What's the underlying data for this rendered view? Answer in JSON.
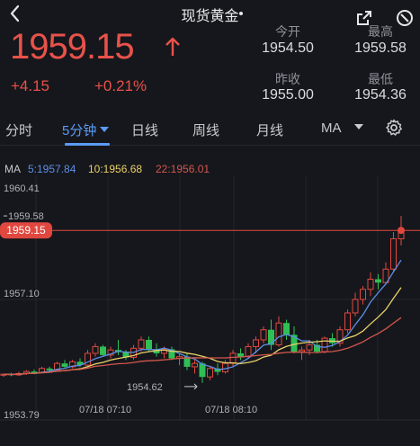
{
  "header": {
    "title": "现货黄金",
    "back_icon": "chevron-left-icon",
    "share_icon": "share-icon",
    "more_icon": "more-icon"
  },
  "quote": {
    "price": "1959.15",
    "change": "+4.15",
    "change_pct": "+0.21%",
    "direction_icon": "arrow-up-icon",
    "color_up": "#e8524a"
  },
  "stats": {
    "open_label": "今开",
    "open": "1954.50",
    "high_label": "最高",
    "high": "1959.58",
    "prev_close_label": "昨收",
    "prev_close": "1955.00",
    "low_label": "最低",
    "low": "1954.36"
  },
  "tabs": [
    {
      "label": "分时",
      "active": false
    },
    {
      "label": "5分钟",
      "active": true,
      "dropdown": true
    },
    {
      "label": "日线",
      "active": false
    },
    {
      "label": "周线",
      "active": false
    },
    {
      "label": "月线",
      "active": false
    },
    {
      "label": "MA",
      "active": false,
      "dropdown": true
    }
  ],
  "settings_icon": "gear-icon",
  "ma_legend": {
    "title": "MA",
    "ma5": "5:1957.84",
    "ma10": "10:1956.68",
    "ma22": "22:1956.01",
    "colors": {
      "ma5": "#5b8fe6",
      "ma10": "#e9d169",
      "ma22": "#d2574d"
    }
  },
  "chart_data": {
    "type": "candlestick",
    "y_ticks": [
      "1960.41",
      "1957.10",
      "1953.79"
    ],
    "x_ticks": [
      "07/18 07:10",
      "07/18 08:10"
    ],
    "ylim": [
      1953.79,
      1960.41
    ],
    "high_marker": "1959.58",
    "low_marker": "1954.62",
    "last_price_tag": "1959.15",
    "last_price": 1959.15,
    "colors": {
      "up": "#e0483f",
      "down": "#2fbf55"
    },
    "candles": [
      [
        1954.85,
        1954.9,
        1954.8,
        1954.88
      ],
      [
        1954.88,
        1954.92,
        1954.82,
        1954.86
      ],
      [
        1954.86,
        1954.95,
        1954.83,
        1954.9
      ],
      [
        1954.9,
        1955.0,
        1954.86,
        1954.96
      ],
      [
        1954.96,
        1955.02,
        1954.88,
        1954.92
      ],
      [
        1954.92,
        1955.1,
        1954.9,
        1955.05
      ],
      [
        1955.05,
        1955.1,
        1954.95,
        1955.0
      ],
      [
        1955.0,
        1955.25,
        1954.98,
        1955.2
      ],
      [
        1955.2,
        1955.3,
        1955.05,
        1955.1
      ],
      [
        1955.1,
        1955.3,
        1955.05,
        1955.25
      ],
      [
        1955.25,
        1955.35,
        1955.1,
        1955.15
      ],
      [
        1955.15,
        1955.6,
        1955.12,
        1955.5
      ],
      [
        1955.5,
        1955.8,
        1955.4,
        1955.7
      ],
      [
        1955.7,
        1955.75,
        1955.4,
        1955.45
      ],
      [
        1955.45,
        1955.7,
        1955.35,
        1955.6
      ],
      [
        1955.6,
        1955.9,
        1955.45,
        1955.55
      ],
      [
        1955.55,
        1955.6,
        1955.3,
        1955.38
      ],
      [
        1955.38,
        1955.75,
        1955.3,
        1955.65
      ],
      [
        1955.65,
        1956.0,
        1955.55,
        1955.9
      ],
      [
        1955.9,
        1956.0,
        1955.55,
        1955.6
      ],
      [
        1955.6,
        1955.8,
        1955.4,
        1955.5
      ],
      [
        1955.5,
        1955.7,
        1955.35,
        1955.62
      ],
      [
        1955.62,
        1955.7,
        1955.3,
        1955.35
      ],
      [
        1955.35,
        1955.5,
        1955.15,
        1955.4
      ],
      [
        1955.4,
        1955.5,
        1955.0,
        1955.1
      ],
      [
        1955.1,
        1955.3,
        1954.9,
        1955.2
      ],
      [
        1955.2,
        1955.25,
        1954.62,
        1954.8
      ],
      [
        1954.8,
        1955.1,
        1954.7,
        1955.05
      ],
      [
        1955.05,
        1955.2,
        1954.85,
        1954.95
      ],
      [
        1954.95,
        1955.3,
        1954.9,
        1955.2
      ],
      [
        1955.2,
        1955.6,
        1955.1,
        1955.5
      ],
      [
        1955.5,
        1955.65,
        1955.3,
        1955.4
      ],
      [
        1955.4,
        1955.8,
        1955.35,
        1955.7
      ],
      [
        1955.7,
        1956.0,
        1955.5,
        1955.9
      ],
      [
        1955.9,
        1956.3,
        1955.8,
        1956.2
      ],
      [
        1956.2,
        1956.5,
        1955.6,
        1955.75
      ],
      [
        1955.75,
        1956.6,
        1955.7,
        1956.4
      ],
      [
        1956.4,
        1956.5,
        1955.9,
        1956.05
      ],
      [
        1956.05,
        1956.3,
        1955.5,
        1955.55
      ],
      [
        1955.55,
        1955.7,
        1955.3,
        1955.6
      ],
      [
        1955.6,
        1955.9,
        1955.45,
        1955.75
      ],
      [
        1955.75,
        1955.9,
        1955.5,
        1955.55
      ],
      [
        1955.55,
        1956.0,
        1955.5,
        1955.95
      ],
      [
        1955.95,
        1956.1,
        1955.7,
        1955.8
      ],
      [
        1955.8,
        1956.3,
        1955.7,
        1956.2
      ],
      [
        1956.2,
        1956.8,
        1956.1,
        1956.7
      ],
      [
        1956.7,
        1957.3,
        1956.6,
        1957.1
      ],
      [
        1957.1,
        1957.5,
        1956.95,
        1957.4
      ],
      [
        1957.4,
        1957.9,
        1957.2,
        1957.7
      ],
      [
        1957.7,
        1957.85,
        1957.4,
        1957.6
      ],
      [
        1957.6,
        1958.2,
        1957.55,
        1958.0
      ],
      [
        1958.0,
        1959.1,
        1957.9,
        1958.9
      ],
      [
        1958.9,
        1959.58,
        1958.7,
        1959.15
      ]
    ]
  }
}
